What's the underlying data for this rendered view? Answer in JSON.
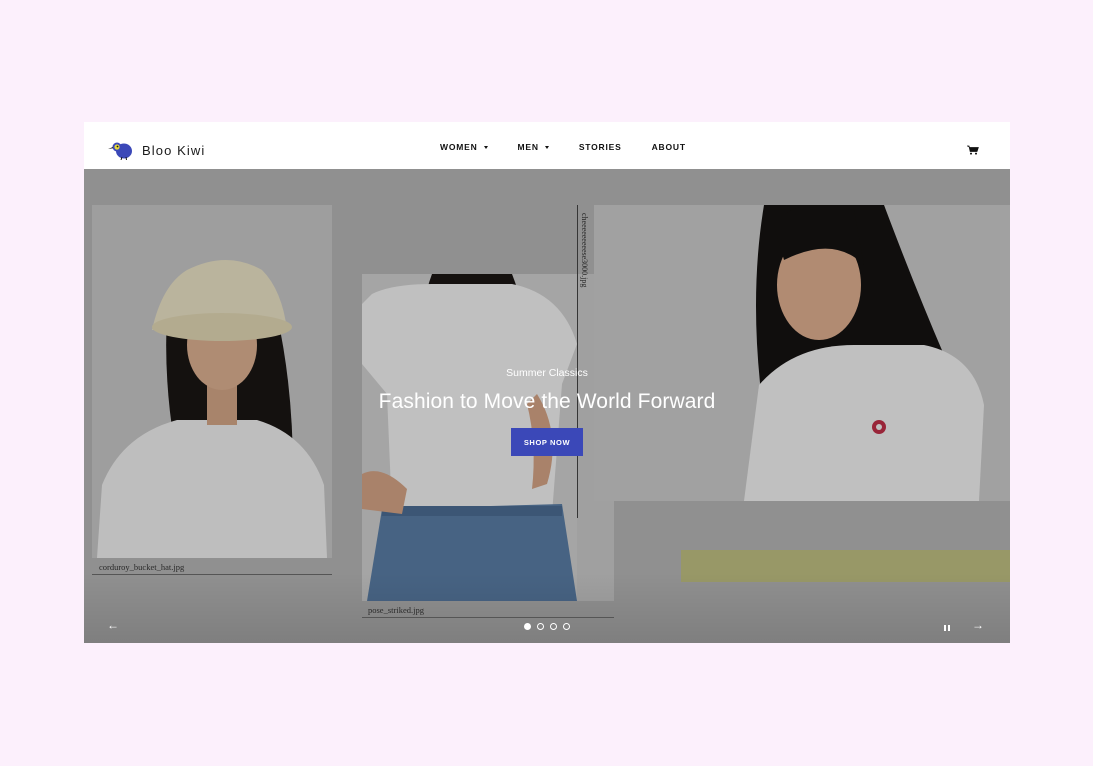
{
  "brand": {
    "name": "Bloo Kiwi",
    "logo_icon": "kiwi-bird-icon",
    "primary_color": "#3b48b8",
    "accent_yellow": "#e4d73c"
  },
  "nav": {
    "items": [
      {
        "label": "WOMEN",
        "has_dropdown": true
      },
      {
        "label": "MEN",
        "has_dropdown": true
      },
      {
        "label": "STORIES",
        "has_dropdown": false
      },
      {
        "label": "ABOUT",
        "has_dropdown": false
      }
    ],
    "cart_icon": "cart-icon"
  },
  "hero": {
    "eyebrow": "Summer Classics",
    "headline": "Fashion to Move the World Forward",
    "cta_label": "SHOP NOW",
    "captions": {
      "left": "corduroy_bucket_hat.jpg",
      "middle": "pose_striked.jpg",
      "vertical": "cheeeeeeeeese3000.jpg"
    }
  },
  "slideshow": {
    "prev_icon": "arrow-left-icon",
    "next_icon": "arrow-right-icon",
    "pause_icon": "pause-icon",
    "total_slides": 4,
    "active_slide": 1
  }
}
